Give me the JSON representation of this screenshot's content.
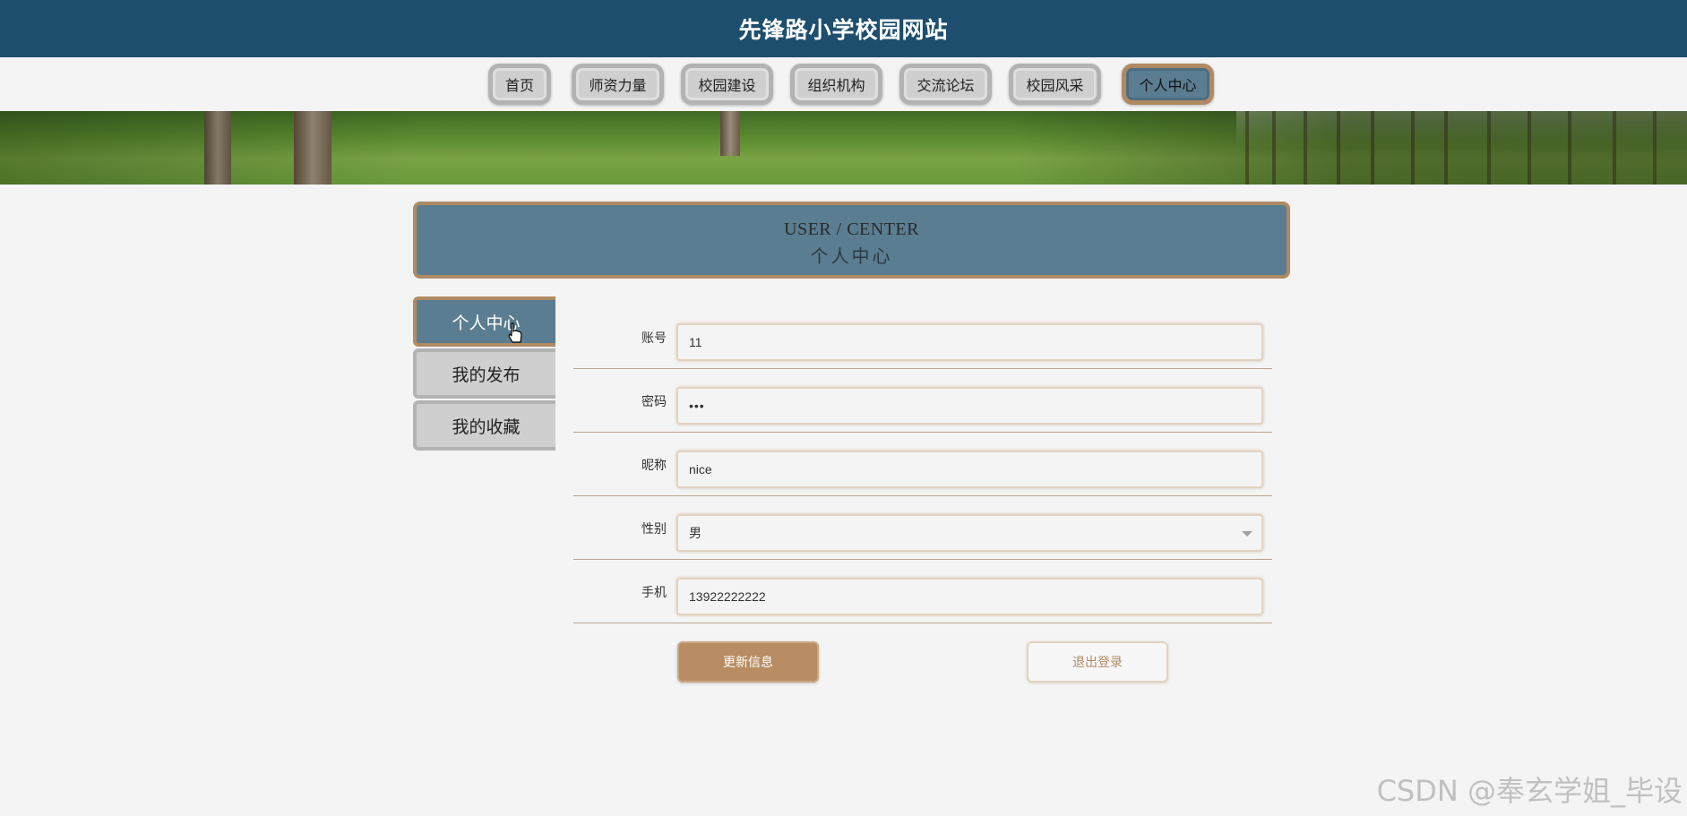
{
  "site": {
    "title": "先锋路小学校园网站"
  },
  "nav": {
    "items": [
      {
        "label": "首页"
      },
      {
        "label": "师资力量"
      },
      {
        "label": "校园建设"
      },
      {
        "label": "组织机构"
      },
      {
        "label": "交流论坛"
      },
      {
        "label": "校园风采"
      },
      {
        "label": "个人中心",
        "active": true
      }
    ]
  },
  "section": {
    "title_en": "USER / CENTER",
    "title_cn": "个人中心"
  },
  "sidebar": {
    "items": [
      {
        "label": "个人中心",
        "active": true
      },
      {
        "label": "我的发布"
      },
      {
        "label": "我的收藏"
      }
    ]
  },
  "form": {
    "account": {
      "label": "账号",
      "value": "11"
    },
    "password": {
      "label": "密码",
      "value": "•••"
    },
    "nickname": {
      "label": "昵称",
      "value": "nice"
    },
    "gender": {
      "label": "性别",
      "value": "男"
    },
    "phone": {
      "label": "手机",
      "value": "13922222222"
    }
  },
  "actions": {
    "update_label": "更新信息",
    "logout_label": "退出登录"
  },
  "watermark": {
    "text": "CSDN @奉玄学姐_毕设"
  },
  "colors": {
    "header": "#1d4e6e",
    "accent": "#5a7d91",
    "border_accent": "#b08a63",
    "button": "#b88d63"
  }
}
